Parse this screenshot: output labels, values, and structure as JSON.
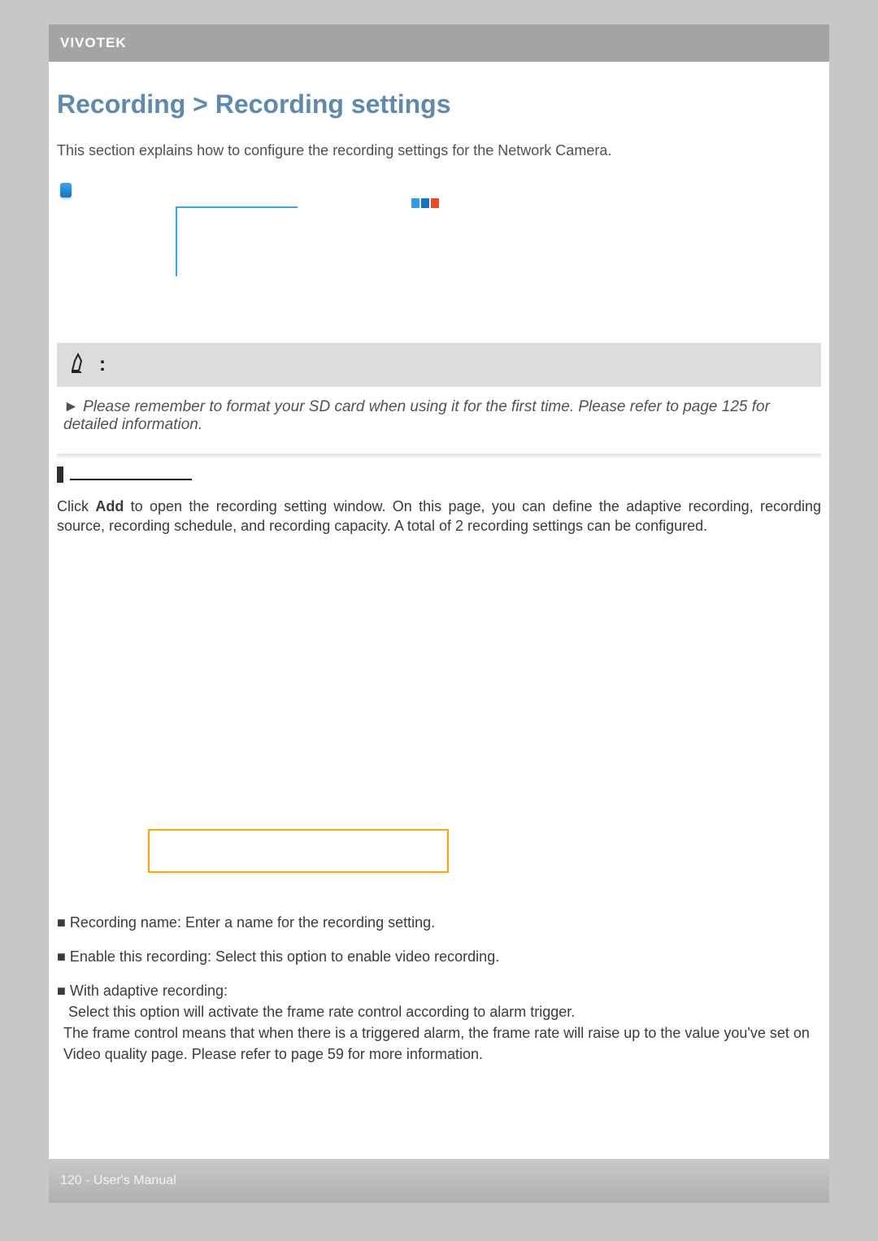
{
  "header": {
    "logo": "VIVOTEK"
  },
  "title": "Recording > Recording settings",
  "intro": "This section explains how to configure the recording settings for the Network Camera.",
  "note": {
    "colon": ":",
    "body": "► Please remember to format your SD card when using it for the first time. Please refer to page 125 for detailed information."
  },
  "rs_paragraph": {
    "pre": "Click ",
    "bold": "Add",
    "post": " to open the recording setting window. On this page, you can define the adaptive recording, recording source, recording schedule, and recording capacity. A total of 2 recording settings can be configured."
  },
  "params": {
    "rec_name": "■ Recording name: Enter a name for the recording setting.",
    "enable": "■ Enable this recording: Select this option to enable video recording.",
    "adaptive_head": "■ With adaptive recording:",
    "adaptive_line1": "Select this option will activate the frame rate control according to alarm trigger.",
    "adaptive_line2": "The frame control means that when there is a triggered alarm, the frame rate will raise up to the value you've set on Video quality page. Please refer to page 59 for more information."
  },
  "footer": "120 - User's Manual",
  "chart_data": null
}
